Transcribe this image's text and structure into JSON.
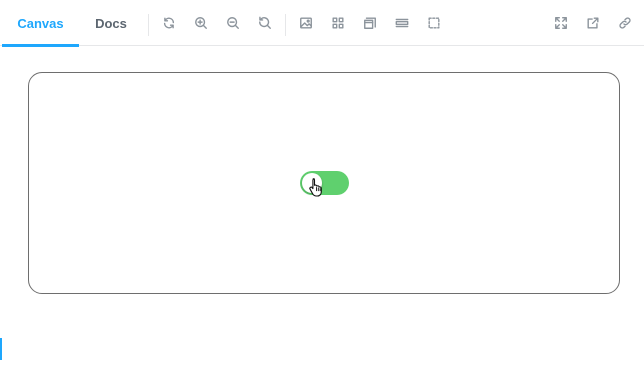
{
  "tabs": [
    {
      "label": "Canvas",
      "active": true
    },
    {
      "label": "Docs",
      "active": false
    }
  ],
  "toolbar": {
    "left_tools": [
      "reload-icon",
      "zoom-in-icon",
      "zoom-out-icon",
      "zoom-reset-icon"
    ],
    "addon_tools": [
      "background-icon",
      "grid-icon",
      "viewport-icon",
      "measure-icon",
      "outline-icon"
    ],
    "right_tools": [
      "fullscreen-icon",
      "open-new-tab-icon",
      "copy-link-icon"
    ]
  },
  "preview": {
    "toggle": {
      "checked": true,
      "color": "#5fd06e"
    }
  },
  "colors": {
    "accent": "#1ea7fd",
    "icon": "#8c949c",
    "tab_inactive": "#5c6670",
    "frame_border": "#6e6e6e"
  }
}
